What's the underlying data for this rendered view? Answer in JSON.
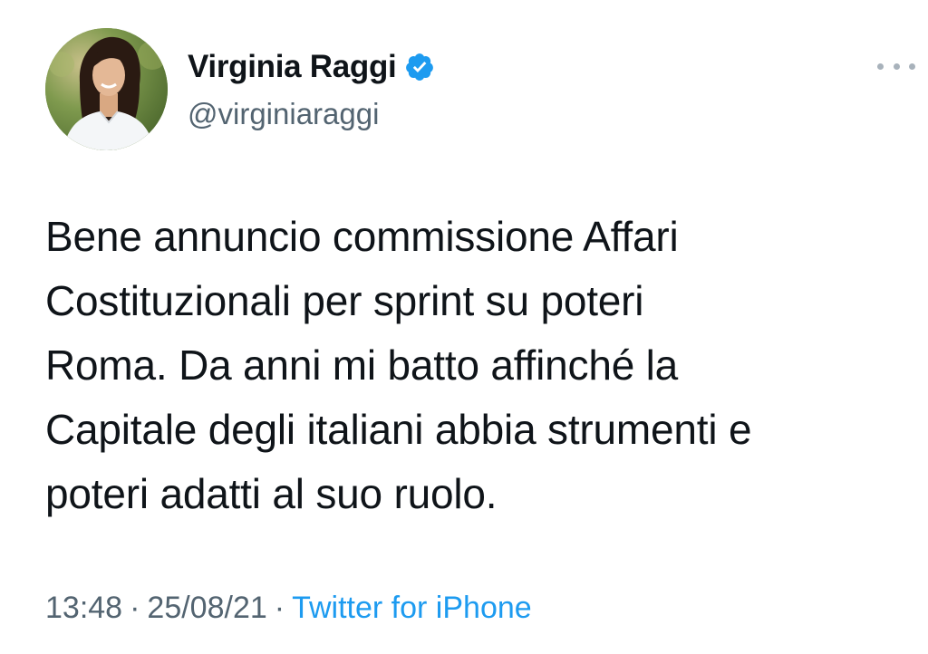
{
  "tweet": {
    "author": {
      "display_name": "Virginia Raggi",
      "handle": "@virginiaraggi",
      "verified_icon": "verified-badge-icon",
      "avatar": "profile-photo"
    },
    "more_icon": "more-options-icon",
    "text": "Bene annuncio commissione Affari\nCostituzionali per sprint su poteri\nRoma. Da anni mi batto affinché la\nCapitale degli italiani abbia strumenti e\npoteri adatti al suo ruolo.",
    "time": "13:48",
    "separator": "·",
    "date": "25/08/21",
    "source": "Twitter for iPhone"
  },
  "colors": {
    "text_primary": "#0f1419",
    "text_secondary": "#536471",
    "accent": "#1d9bf0",
    "background": "#ffffff"
  }
}
